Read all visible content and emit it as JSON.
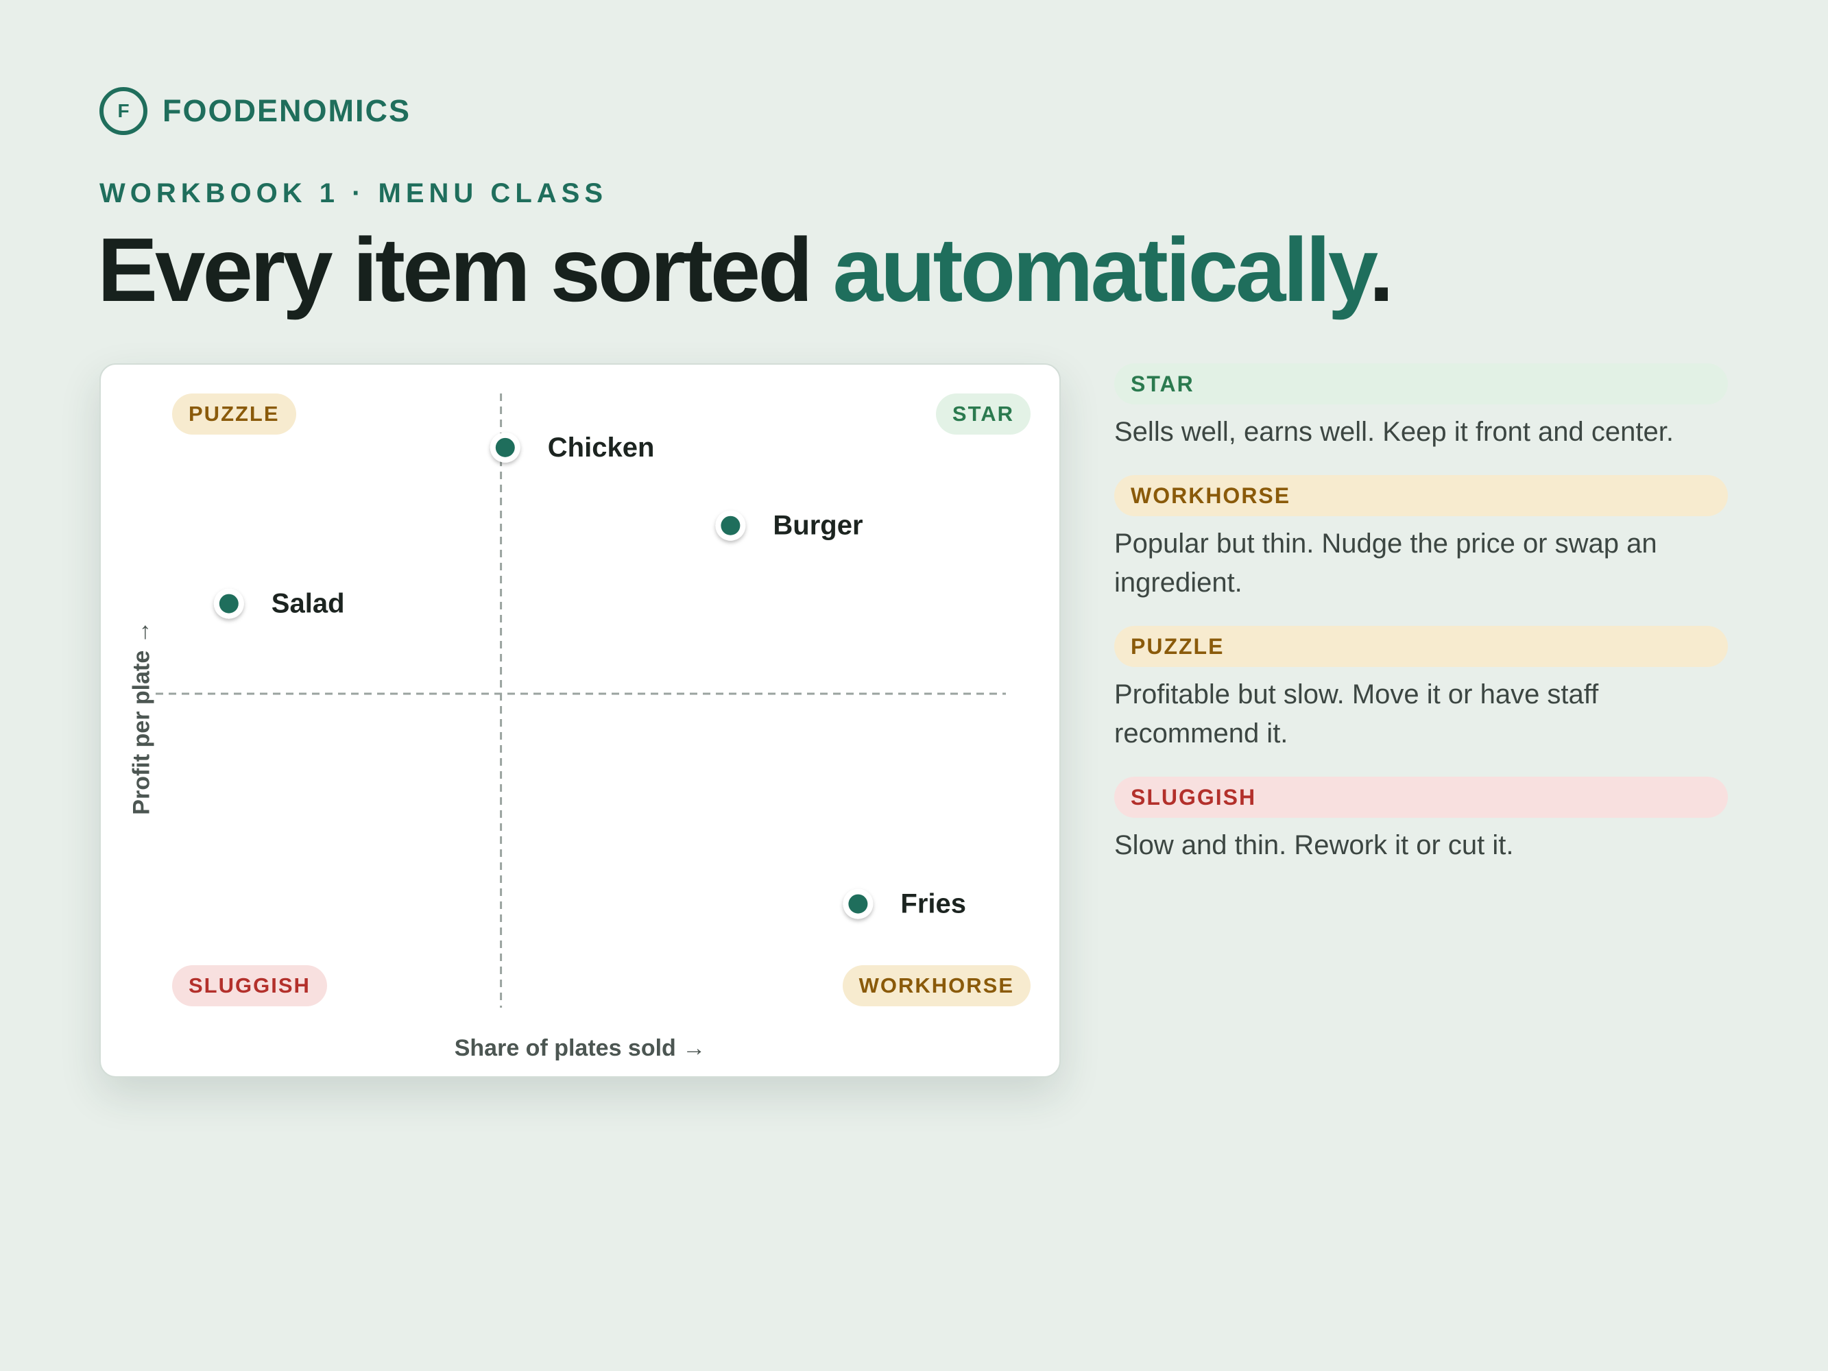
{
  "brand": {
    "logo_letter": "F",
    "name": "FOODENOMICS"
  },
  "eyebrow": "WORKBOOK 1 · MENU CLASS",
  "headline": {
    "main": "Every item sorted ",
    "accent": "automatically",
    "end": "."
  },
  "colors": {
    "accent": "#1f6e5c",
    "background": "#e8efea",
    "point": "#1f6e5c"
  },
  "chart_data": {
    "type": "scatter",
    "xlabel": "Share of plates sold →",
    "ylabel": "Profit per plate →",
    "xlim": [
      0,
      1
    ],
    "ylim": [
      0,
      1
    ],
    "x_divider": 0.39,
    "y_divider": 0.5,
    "grid": false,
    "points": [
      {
        "label": "Chicken",
        "x": 0.395,
        "y": 0.91
      },
      {
        "label": "Burger",
        "x": 0.66,
        "y": 0.78
      },
      {
        "label": "Salad",
        "x": 0.07,
        "y": 0.65
      },
      {
        "label": "Fries",
        "x": 0.81,
        "y": 0.15
      }
    ],
    "quadrants": {
      "top_left": "PUZZLE",
      "top_right": "STAR",
      "bottom_left": "SLUGGISH",
      "bottom_right": "WORKHORSE"
    }
  },
  "legend": [
    {
      "tag": "STAR",
      "text": "Sells well, earns well. Keep it front and center."
    },
    {
      "tag": "WORKHORSE",
      "text": "Popular but thin. Nudge the price or swap an ingredient."
    },
    {
      "tag": "PUZZLE",
      "text": "Profitable but slow. Move it or have staff recommend it."
    },
    {
      "tag": "SLUGGISH",
      "text": "Slow and thin. Rework it or cut it."
    }
  ]
}
